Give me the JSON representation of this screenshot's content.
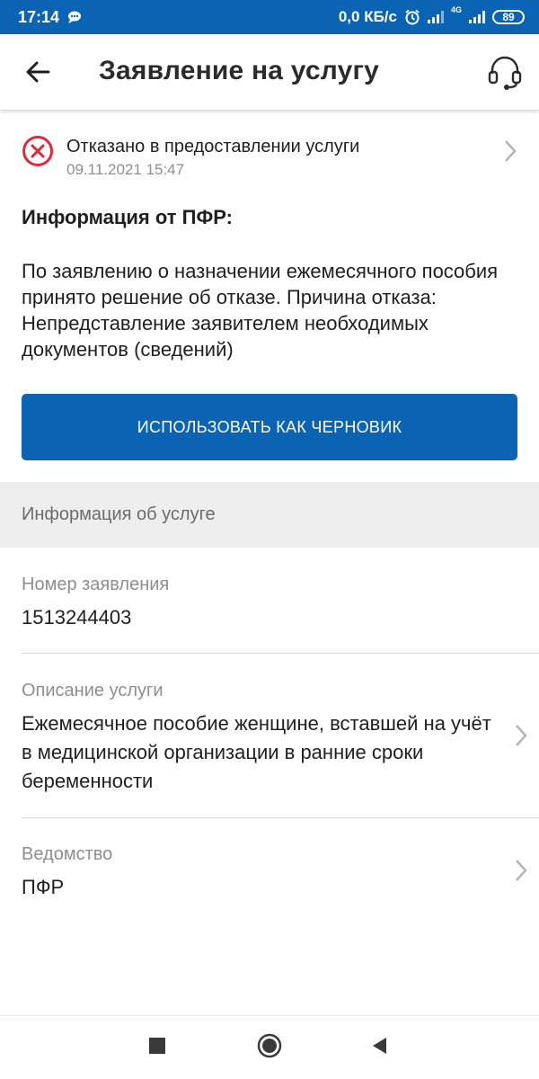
{
  "status_bar": {
    "time": "17:14",
    "speed": "0,0 КБ/с",
    "network": "4G",
    "battery": "89"
  },
  "app_bar": {
    "title": "Заявление на услугу",
    "back_icon": "arrow-left-icon",
    "support_icon": "headset-support-icon"
  },
  "status": {
    "text": "Отказано в предоставлении услуги",
    "date": "09.11.2021 15:47",
    "icon": "error-circle-icon",
    "color": "#e0283c"
  },
  "pfr_info": {
    "title": "Информация от ПФР:",
    "text": "По заявлению о назначении ежемесячного пособия принято решение об отказе. Причина отказа: Непредставление заявителем необходимых документов (сведений)"
  },
  "draft_button": {
    "label": "ИСПОЛЬЗОВАТЬ КАК ЧЕРНОВИК",
    "color": "#0b64b3"
  },
  "section": {
    "title": "Информация об услуге"
  },
  "fields": [
    {
      "label": "Номер заявления",
      "value": "1513244403"
    },
    {
      "label": "Описание услуги",
      "value": "Ежемесячное пособие женщине, вставшей на учёт в медицинской организации в ранние сроки беременности"
    },
    {
      "label": "Ведомство",
      "value": "ПФР"
    }
  ],
  "nav_bar": {
    "recents_icon": "square-recents-icon",
    "home_icon": "circle-home-icon",
    "back_icon": "triangle-back-icon"
  }
}
